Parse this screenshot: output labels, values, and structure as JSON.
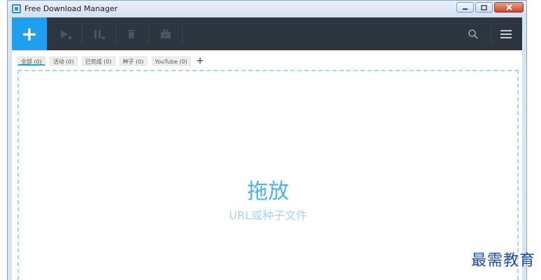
{
  "window": {
    "title": "Free Download Manager"
  },
  "toolbar": {
    "add_label": "+",
    "icons": [
      "play-icon",
      "pause-icon",
      "trash-icon",
      "briefcase-icon",
      "search-icon",
      "menu-icon"
    ]
  },
  "tabs": [
    {
      "label": "全部 (0)",
      "active": true
    },
    {
      "label": "活动 (0)",
      "active": false
    },
    {
      "label": "已完成 (0)",
      "active": false
    },
    {
      "label": "种子 (0)",
      "active": false
    },
    {
      "label": "YouTube (0)",
      "active": false
    }
  ],
  "tab_add_label": "+",
  "dropzone": {
    "title": "拖放",
    "subtitle": "URL或种子文件"
  },
  "watermark": "最需教育",
  "colors": {
    "accent": "#1ea0ee",
    "toolbar_bg": "#2c3540",
    "drop_title": "#4fb0ee",
    "drop_sub": "#a8d3f1"
  }
}
